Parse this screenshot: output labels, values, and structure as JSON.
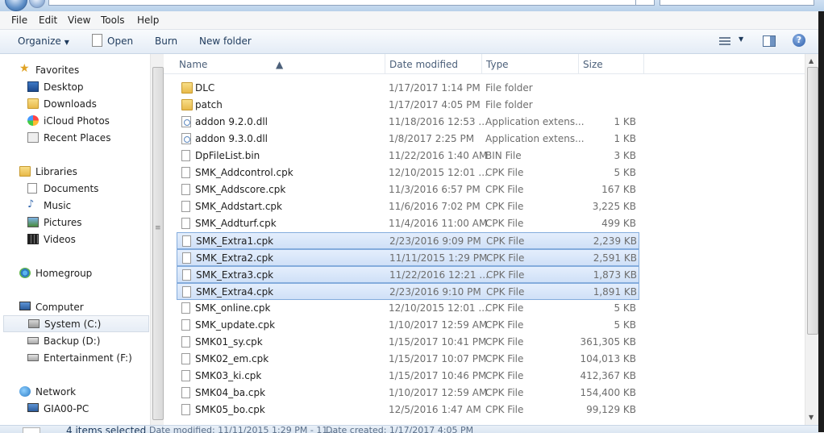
{
  "menu": [
    "File",
    "Edit",
    "View",
    "Tools",
    "Help"
  ],
  "toolbar": {
    "organize": "Organize",
    "open": "Open",
    "burn": "Burn",
    "new_folder": "New folder",
    "help": "?"
  },
  "columns": {
    "name": "Name",
    "date": "Date modified",
    "type": "Type",
    "size": "Size"
  },
  "nav": {
    "favorites": "Favorites",
    "desktop": "Desktop",
    "downloads": "Downloads",
    "icloud": "iCloud Photos",
    "recent": "Recent Places",
    "libraries": "Libraries",
    "documents": "Documents",
    "music": "Music",
    "pictures": "Pictures",
    "videos": "Videos",
    "homegroup": "Homegroup",
    "computer": "Computer",
    "system": "System (C:)",
    "backup": "Backup (D:)",
    "entertainment": "Entertainment (F:)",
    "network": "Network",
    "gia": "GIA00-PC"
  },
  "files": [
    {
      "name": "DLC",
      "date": "1/17/2017 1:14 PM",
      "type": "File folder",
      "size": "",
      "icon": "folder",
      "selected": false
    },
    {
      "name": "patch",
      "date": "1/17/2017 4:05 PM",
      "type": "File folder",
      "size": "",
      "icon": "folder",
      "selected": false
    },
    {
      "name": "addon 9.2.0.dll",
      "date": "11/18/2016 12:53 ...",
      "type": "Application extens...",
      "size": "1 KB",
      "icon": "dll",
      "selected": false
    },
    {
      "name": "addon 9.3.0.dll",
      "date": "1/8/2017 2:25 PM",
      "type": "Application extens...",
      "size": "1 KB",
      "icon": "dll",
      "selected": false
    },
    {
      "name": "DpFileList.bin",
      "date": "11/22/2016 1:40 AM",
      "type": "BIN File",
      "size": "3 KB",
      "icon": "file",
      "selected": false
    },
    {
      "name": "SMK_Addcontrol.cpk",
      "date": "12/10/2015 12:01 ...",
      "type": "CPK File",
      "size": "5 KB",
      "icon": "file",
      "selected": false
    },
    {
      "name": "SMK_Addscore.cpk",
      "date": "11/3/2016 6:57 PM",
      "type": "CPK File",
      "size": "167 KB",
      "icon": "file",
      "selected": false
    },
    {
      "name": "SMK_Addstart.cpk",
      "date": "11/6/2016 7:02 PM",
      "type": "CPK File",
      "size": "3,225 KB",
      "icon": "file",
      "selected": false
    },
    {
      "name": "SMK_Addturf.cpk",
      "date": "11/4/2016 11:00 AM",
      "type": "CPK File",
      "size": "499 KB",
      "icon": "file",
      "selected": false
    },
    {
      "name": "SMK_Extra1.cpk",
      "date": "2/23/2016 9:09 PM",
      "type": "CPK File",
      "size": "2,239 KB",
      "icon": "file",
      "selected": true
    },
    {
      "name": "SMK_Extra2.cpk",
      "date": "11/11/2015 1:29 PM",
      "type": "CPK File",
      "size": "2,591 KB",
      "icon": "file",
      "selected": true
    },
    {
      "name": "SMK_Extra3.cpk",
      "date": "11/22/2016 12:21 ...",
      "type": "CPK File",
      "size": "1,873 KB",
      "icon": "file",
      "selected": true
    },
    {
      "name": "SMK_Extra4.cpk",
      "date": "2/23/2016 9:10 PM",
      "type": "CPK File",
      "size": "1,891 KB",
      "icon": "file",
      "selected": true
    },
    {
      "name": "SMK_online.cpk",
      "date": "12/10/2015 12:01 ...",
      "type": "CPK File",
      "size": "5 KB",
      "icon": "file",
      "selected": false
    },
    {
      "name": "SMK_update.cpk",
      "date": "1/10/2017 12:59 AM",
      "type": "CPK File",
      "size": "5 KB",
      "icon": "file",
      "selected": false
    },
    {
      "name": "SMK01_sy.cpk",
      "date": "1/15/2017 10:41 PM",
      "type": "CPK File",
      "size": "361,305 KB",
      "icon": "file",
      "selected": false
    },
    {
      "name": "SMK02_em.cpk",
      "date": "1/15/2017 10:07 PM",
      "type": "CPK File",
      "size": "104,013 KB",
      "icon": "file",
      "selected": false
    },
    {
      "name": "SMK03_ki.cpk",
      "date": "1/15/2017 10:46 PM",
      "type": "CPK File",
      "size": "412,367 KB",
      "icon": "file",
      "selected": false
    },
    {
      "name": "SMK04_ba.cpk",
      "date": "1/10/2017 12:59 AM",
      "type": "CPK File",
      "size": "154,400 KB",
      "icon": "file",
      "selected": false
    },
    {
      "name": "SMK05_bo.cpk",
      "date": "12/5/2016 1:47 AM",
      "type": "CPK File",
      "size": "99,129 KB",
      "icon": "file",
      "selected": false
    }
  ],
  "status": {
    "selected": "4 items selected",
    "date_modified": "Date modified: 11/11/2015 1:29 PM - 11...",
    "date_created": "Date created: 1/17/2017 4:05 PM"
  },
  "colors": {
    "selection": "#cfe0f7",
    "selection_border": "#84acdd",
    "toolbar_text": "#1e3a5c"
  }
}
